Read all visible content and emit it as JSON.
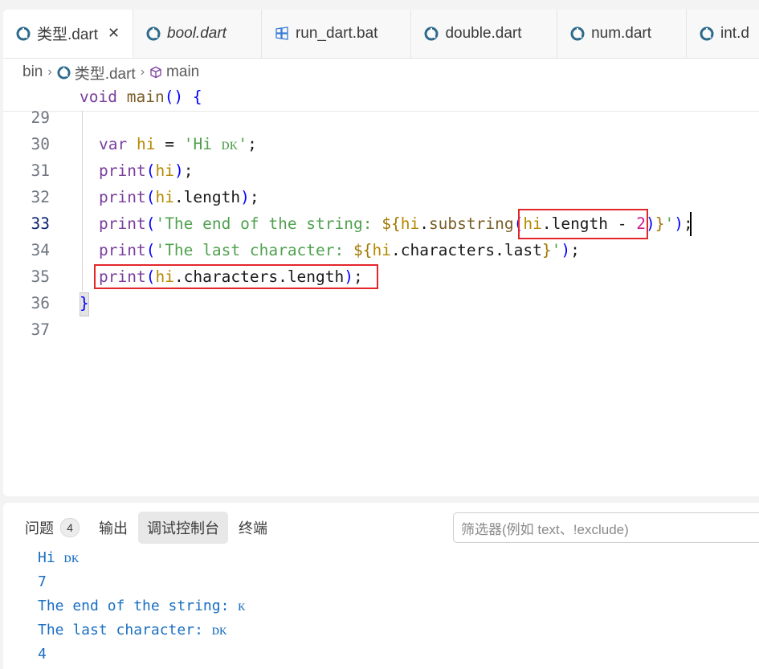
{
  "tabs": [
    {
      "label": "类型.dart",
      "active": true,
      "italic": false,
      "icon": "dart-icon",
      "close": "✕"
    },
    {
      "label": "bool.dart",
      "active": false,
      "italic": true,
      "icon": "dart-icon"
    },
    {
      "label": "run_dart.bat",
      "active": false,
      "italic": false,
      "icon": "windows-icon"
    },
    {
      "label": "double.dart",
      "active": false,
      "italic": false,
      "icon": "dart-icon"
    },
    {
      "label": "num.dart",
      "active": false,
      "italic": false,
      "icon": "dart-icon"
    },
    {
      "label": "int.d",
      "active": false,
      "italic": false,
      "icon": "dart-icon"
    }
  ],
  "breadcrumb": {
    "folder": "bin",
    "file": "类型.dart",
    "symbol": "main"
  },
  "sticky": {
    "text": "void main() {"
  },
  "lines": [
    {
      "num": "29",
      "text": ""
    },
    {
      "num": "30",
      "text": "var hi = 'Hi ᴅᴋ';"
    },
    {
      "num": "31",
      "text": "print(hi);"
    },
    {
      "num": "32",
      "text": "print(hi.length);"
    },
    {
      "num": "33",
      "text": "print('The end of the string: ${hi.substring(hi.length - 2)}');"
    },
    {
      "num": "34",
      "text": "print('The last character: ${hi.characters.last}');"
    },
    {
      "num": "35",
      "text": "print(hi.characters.length);"
    },
    {
      "num": "36",
      "text": "}"
    },
    {
      "num": "37",
      "text": ""
    }
  ],
  "panel": {
    "tabs": [
      {
        "label": "问题",
        "badge": "4"
      },
      {
        "label": "输出"
      },
      {
        "label": "调试控制台",
        "active": true
      },
      {
        "label": "终端"
      }
    ],
    "filter_placeholder": "筛选器(例如 text、!exclude)",
    "output": [
      "Hi ᴅᴋ",
      "7",
      "The end of the string: ᴋ",
      "The last character: ᴅᴋ",
      "4"
    ]
  },
  "colors": {
    "accent_red": "#e3262a",
    "output_blue": "#1a6fc2",
    "dart_icon": "#2c6a8c"
  }
}
